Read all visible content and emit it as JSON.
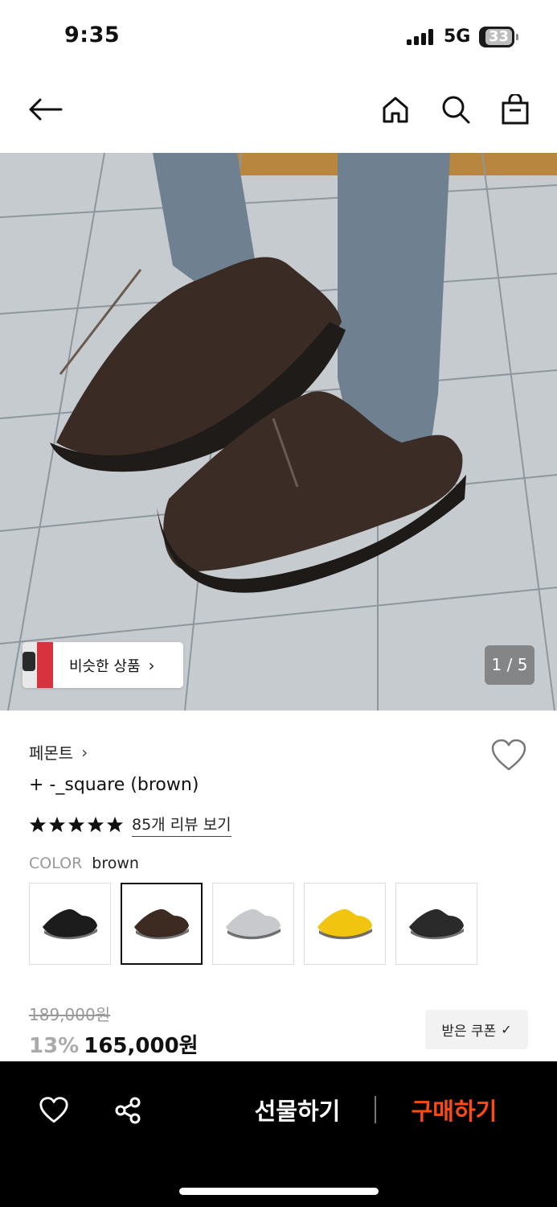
{
  "status_bar": {
    "time": "9:35",
    "network": "5G",
    "battery": "33"
  },
  "gallery": {
    "similar_label": "비슷한 상품",
    "page_indicator": "1 / 5"
  },
  "product": {
    "brand": "페몬트",
    "name": "+ -_square (brown)",
    "rating_stars": 5,
    "review_link": "85개 리뷰 보기",
    "color_key": "COLOR",
    "color_value": "brown",
    "swatches": [
      {
        "color": "black",
        "hex": "#1c1c1c",
        "selected": false
      },
      {
        "color": "brown",
        "hex": "#3d2b22",
        "selected": true
      },
      {
        "color": "silver",
        "hex": "#c8c9cc",
        "selected": false
      },
      {
        "color": "yellow",
        "hex": "#f1c40f",
        "selected": false
      },
      {
        "color": "black",
        "hex": "#2a2a2a",
        "selected": false
      }
    ]
  },
  "price": {
    "original": "189,000원",
    "discount": "13%",
    "sale": "165,000원",
    "coupon_label": "받은 쿠폰"
  },
  "bottom_bar": {
    "gift_label": "선물하기",
    "buy_label": "구매하기",
    "accent_color": "#ff4b12"
  },
  "icons": [
    "back-arrow-icon",
    "home-icon",
    "search-icon",
    "shopping-bag-icon",
    "heart-icon",
    "share-icon",
    "chevron-right-icon",
    "check-icon",
    "star-icon"
  ]
}
